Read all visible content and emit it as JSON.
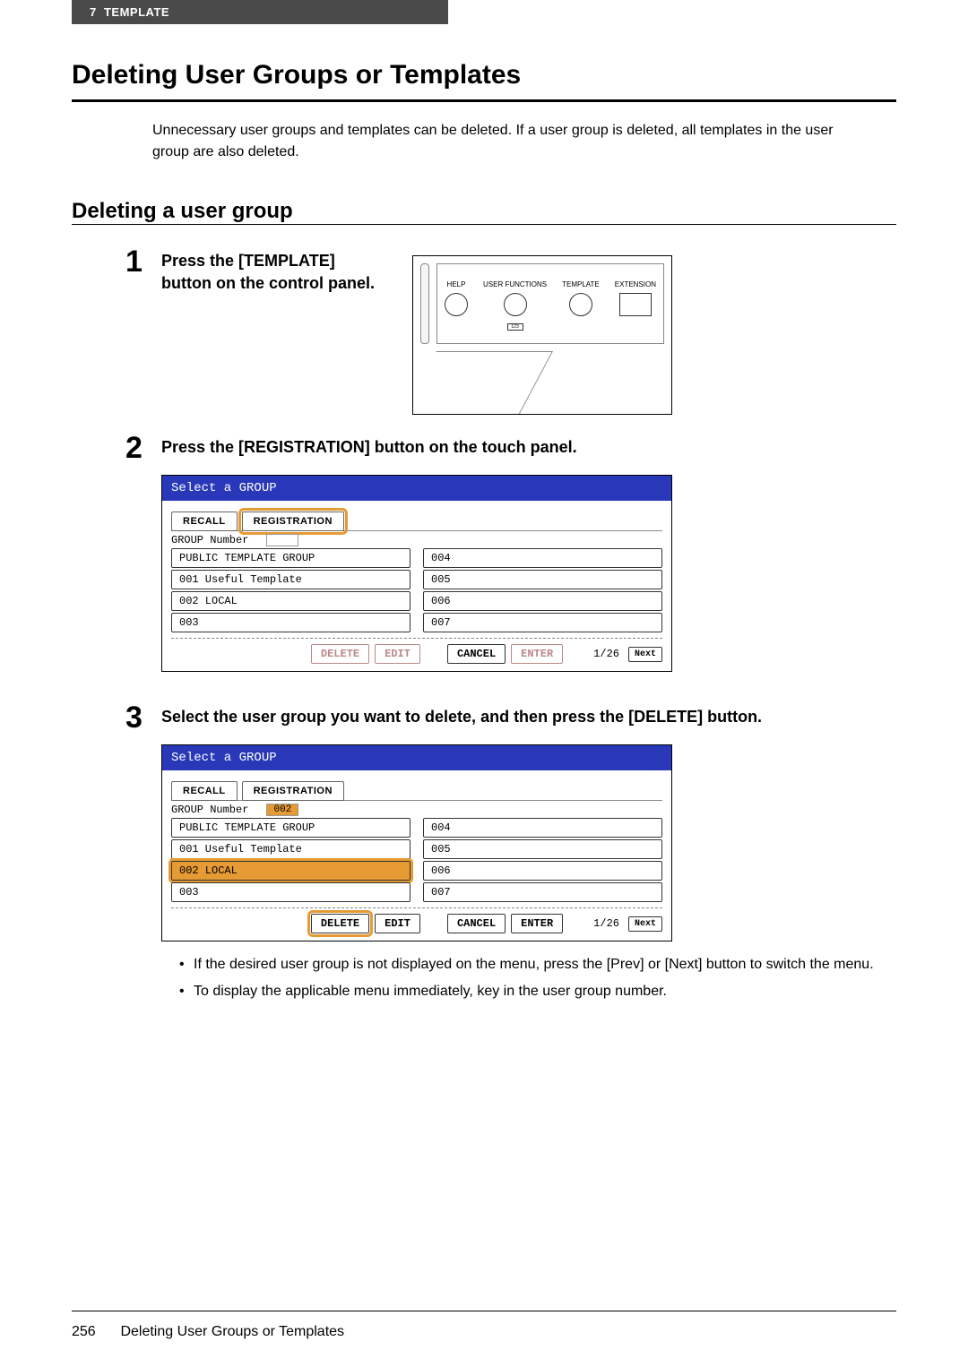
{
  "header": {
    "chapter_num": "7",
    "chapter_title": "TEMPLATE"
  },
  "title": "Deleting User Groups or Templates",
  "intro": "Unnecessary user groups and templates can be deleted. If a user group is deleted, all templates in the user group are also deleted.",
  "subheading": "Deleting a user group",
  "step1": {
    "num": "1",
    "text": "Press the [TEMPLATE] button on the control panel.",
    "panel": {
      "help": "HELP",
      "user_functions": "USER FUNCTIONS",
      "template": "TEMPLATE",
      "extension": "EXTENSION",
      "counter": "123"
    }
  },
  "step2": {
    "num": "2",
    "text": "Press the [REGISTRATION] button on the touch panel.",
    "lcd": {
      "title": "Select a GROUP",
      "tabs": {
        "recall": "RECALL",
        "registration": "REGISTRATION"
      },
      "group_num_label": "GROUP Number",
      "group_num_val": "",
      "left": [
        "PUBLIC TEMPLATE GROUP",
        "001 Useful Template",
        "002 LOCAL",
        "003"
      ],
      "right": [
        "004",
        "005",
        "006",
        "007"
      ],
      "btns": {
        "delete": "DELETE",
        "edit": "EDIT",
        "cancel": "CANCEL",
        "enter": "ENTER",
        "next": "Next"
      },
      "page": "1/26"
    }
  },
  "step3": {
    "num": "3",
    "text": "Select the user group you want to delete, and then press the [DELETE] button.",
    "lcd": {
      "title": "Select a GROUP",
      "tabs": {
        "recall": "RECALL",
        "registration": "REGISTRATION"
      },
      "group_num_label": "GROUP Number",
      "group_num_val": "002",
      "left": [
        "PUBLIC TEMPLATE GROUP",
        "001 Useful Template",
        "002 LOCAL",
        "003"
      ],
      "right": [
        "004",
        "005",
        "006",
        "007"
      ],
      "btns": {
        "delete": "DELETE",
        "edit": "EDIT",
        "cancel": "CANCEL",
        "enter": "ENTER",
        "next": "Next"
      },
      "page": "1/26"
    },
    "notes": [
      "If the desired user group is not displayed on the menu, press the [Prev] or [Next] button to switch the menu.",
      "To display the applicable menu immediately, key in the user group number."
    ]
  },
  "footer": {
    "page": "256",
    "title": "Deleting User Groups or Templates"
  }
}
